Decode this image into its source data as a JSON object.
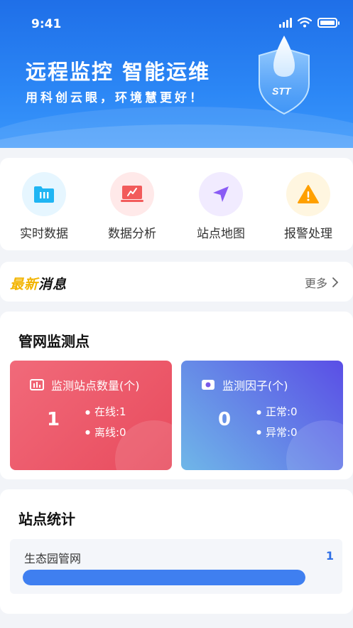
{
  "status": {
    "time": "9:41"
  },
  "banner": {
    "title": "远程监控 智能运维",
    "subtitle": "用科创云眼，环境慧更好！"
  },
  "menu": {
    "items": [
      {
        "label": "实时数据",
        "icon": "bar-chart-folder-icon",
        "bg": "#e6f6ff",
        "color": "#20b5f3"
      },
      {
        "label": "数据分析",
        "icon": "trend-chart-icon",
        "bg": "#ffe9e9",
        "color": "#f25b5b"
      },
      {
        "label": "站点地图",
        "icon": "navigation-arrow-icon",
        "bg": "#f1ebff",
        "color": "#8a5cf5"
      },
      {
        "label": "报警处理",
        "icon": "warning-icon",
        "bg": "#fff6e0",
        "color": "#ffa000"
      }
    ]
  },
  "news": {
    "logo_part1": "最新",
    "logo_part2": "消息",
    "more": "更多"
  },
  "monitor": {
    "title": "管网监测点",
    "stations": {
      "label": "监测站点数量(个)",
      "count": "1",
      "online": "在线:1",
      "offline": "离线:0",
      "color_start": "#f16a7a",
      "color_end": "#e84b5d"
    },
    "factors": {
      "label": "监测因子(个)",
      "count": "0",
      "normal": "正常:0",
      "abnormal": "异常:0",
      "color_start": "#6fb7e8",
      "color_end": "#5a4ee6"
    }
  },
  "station_stats": {
    "title": "站点统计",
    "rows": [
      {
        "name": "生态园管网",
        "count": "1",
        "progress_fraction": 1.0
      }
    ]
  }
}
